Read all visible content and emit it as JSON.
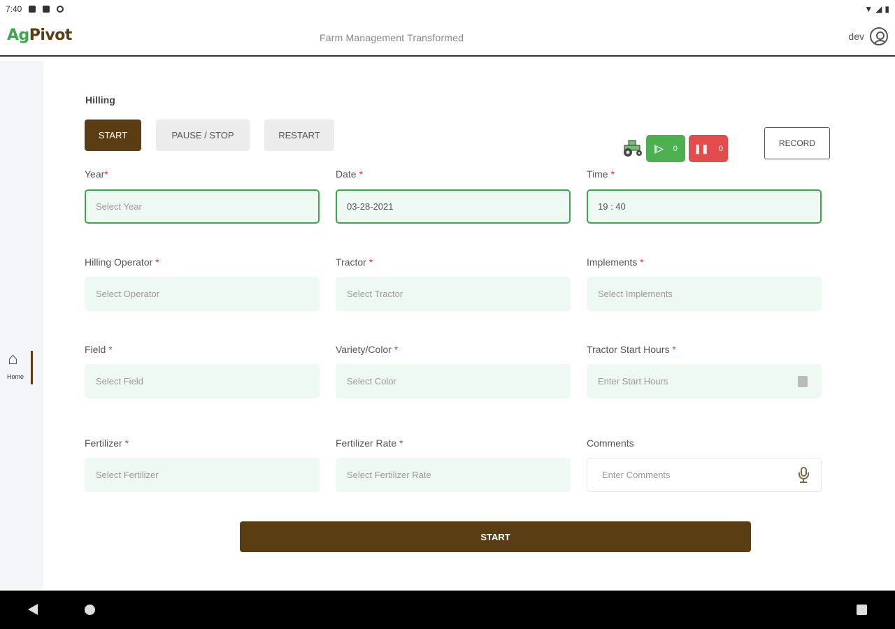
{
  "status_bar": {
    "time": "7:40"
  },
  "header": {
    "logo_ag": "Ag",
    "logo_pivot": "Pivot",
    "tagline": "Farm Management Transformed",
    "user": "dev"
  },
  "sidebar": {
    "home_label": "Home"
  },
  "form": {
    "title": "Hilling",
    "buttons": {
      "start": "START",
      "pause_stop": "PAUSE / STOP",
      "restart": "RESTART",
      "record": "RECORD",
      "start_main": "START"
    },
    "counters": {
      "green_value": "0",
      "red_value": "0"
    },
    "fields": {
      "year": {
        "label": "Year",
        "placeholder": "Select Year"
      },
      "date": {
        "label": "Date",
        "value": "03-28-2021"
      },
      "time": {
        "label": "Time",
        "value": "19 : 40"
      },
      "operator": {
        "label": "Hilling Operator",
        "placeholder": "Select Operator"
      },
      "tractor": {
        "label": "Tractor",
        "placeholder": "Select Tractor"
      },
      "implements": {
        "label": "Implements",
        "placeholder": "Select Implements"
      },
      "field": {
        "label": "Field",
        "placeholder": "Select Field"
      },
      "variety": {
        "label": "Variety/Color",
        "placeholder": "Select Color"
      },
      "start_hours": {
        "label": "Tractor Start Hours",
        "placeholder": "Enter Start Hours"
      },
      "fertilizer": {
        "label": "Fertilizer",
        "placeholder": "Select Fertilizer"
      },
      "fertilizer_rate": {
        "label": "Fertilizer Rate",
        "placeholder": "Select Fertilizer Rate"
      },
      "comments": {
        "label": "Comments",
        "placeholder": "Enter Comments"
      }
    },
    "required_marker": "*"
  },
  "colors": {
    "brand_brown": "#5b3d14",
    "brand_green": "#3aa84a",
    "field_bg": "#eef9f3",
    "counter_green": "#4caf50",
    "counter_red": "#e34c4c"
  }
}
